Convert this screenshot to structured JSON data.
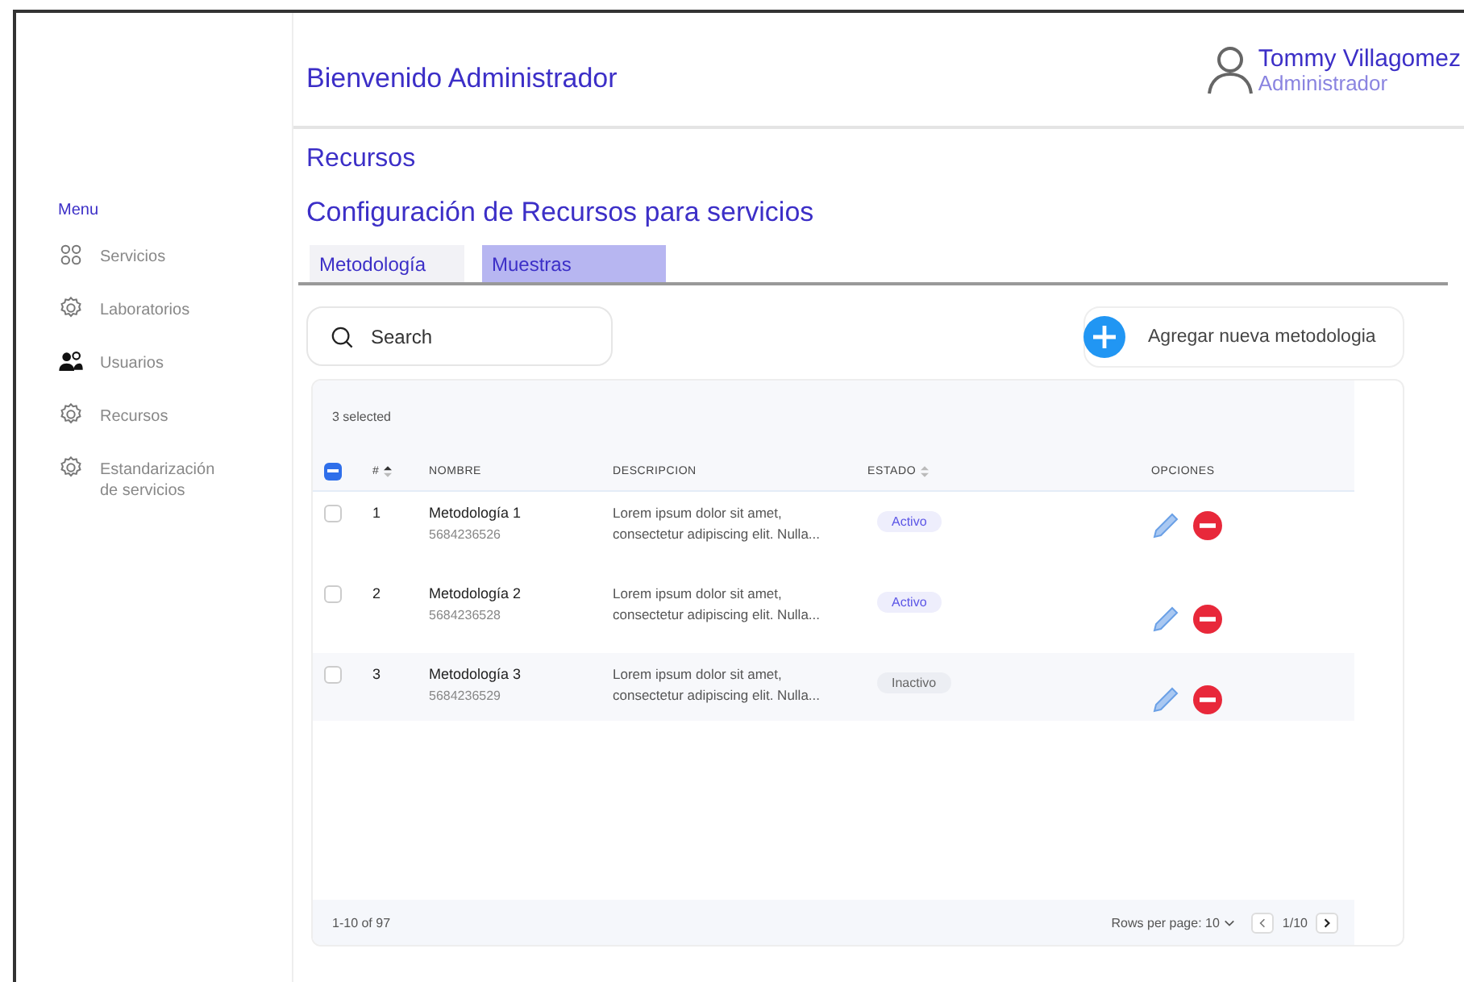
{
  "sidebar": {
    "heading": "Menu",
    "items": [
      {
        "label": "Servicios",
        "kind": "grid"
      },
      {
        "label": "Laboratorios",
        "kind": "gear"
      },
      {
        "label": "Usuarios",
        "kind": "users"
      },
      {
        "label": "Recursos",
        "kind": "gear"
      },
      {
        "label": "Estandarización de servicios",
        "kind": "gear"
      }
    ]
  },
  "header": {
    "greeting": "Bienvenido Administrador",
    "user": {
      "name": "Tommy Villagomez",
      "role": "Administrador"
    }
  },
  "page": {
    "title": "Recursos",
    "subtitle": "Configuración de Recursos para servicios"
  },
  "tabs": [
    {
      "label": "Metodología",
      "selected": false
    },
    {
      "label": "Muestras",
      "selected": true
    }
  ],
  "search": {
    "placeholder": "Search"
  },
  "add_button": {
    "label": "Agregar nueva metodologia"
  },
  "table": {
    "selection_text": "3 selected",
    "header_checked": true,
    "columns": [
      "#",
      "NOMBRE",
      "DESCRIPCION",
      "ESTADO",
      "OPCIONES"
    ],
    "rows": [
      {
        "checked": false,
        "highlighted": false,
        "number": "1",
        "name": "Metodología 1",
        "code": "5684236526",
        "description": "Lorem ipsum dolor sit amet, consectetur adipiscing elit. Nulla...",
        "status": "Activo",
        "active": true
      },
      {
        "checked": false,
        "highlighted": false,
        "number": "2",
        "name": "Metodología 2",
        "code": "5684236528",
        "description": "Lorem ipsum dolor sit amet, consectetur adipiscing elit. Nulla...",
        "status": "Activo",
        "active": true
      },
      {
        "checked": false,
        "highlighted": true,
        "number": "3",
        "name": "Metodología 3",
        "code": "5684236529",
        "description": "Lorem ipsum dolor sit amet, consectetur adipiscing elit. Nulla...",
        "status": "Inactivo",
        "active": false
      }
    ],
    "footer": {
      "range": "1-10 of 97",
      "rows_per_page": "Rows per page: 10",
      "page": "1/10"
    }
  }
}
